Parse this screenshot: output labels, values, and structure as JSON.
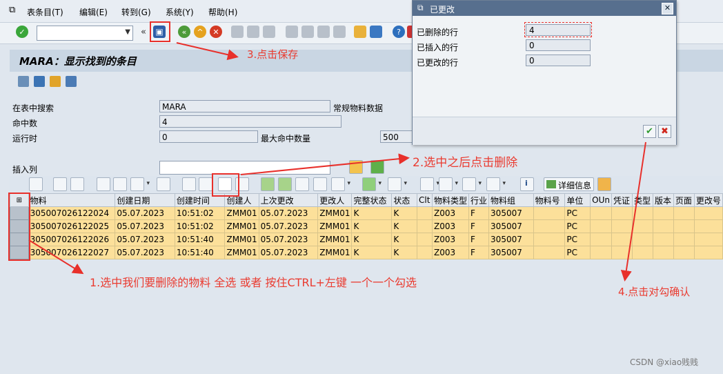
{
  "menu": {
    "items": [
      "表条目(T)",
      "编辑(E)",
      "转到(G)",
      "系统(Y)",
      "帮助(H)"
    ]
  },
  "toolbar": {
    "command_value": ""
  },
  "screen": {
    "title": "MARA：显示找到的条目"
  },
  "form": {
    "search_label": "在表中搜索",
    "search_value": "MARA",
    "search_desc": "常规物料数据",
    "hits_label": "命中数",
    "hits_value": "4",
    "runtime_label": "运行时",
    "runtime_value": "0",
    "maxhits_label": "最大命中数量",
    "maxhits_value": "500",
    "insert_label": "插入列"
  },
  "alv": {
    "details_label": "详细信息"
  },
  "grid": {
    "columns": [
      "物料",
      "创建日期",
      "创建时间",
      "创建人",
      "上次更改",
      "更改人",
      "完整状态",
      "状态",
      "Clt",
      "物料类型",
      "行业",
      "物料组",
      "物料号",
      "单位",
      "OUn",
      "凭证",
      "类型",
      "版本",
      "页面",
      "更改号"
    ],
    "rows": [
      [
        "305007026122024",
        "05.07.2023",
        "10:51:02",
        "ZMM01",
        "05.07.2023",
        "ZMM01",
        "K",
        "K",
        "",
        "Z003",
        "F",
        "305007",
        "",
        "PC",
        "",
        "",
        "",
        "",
        "",
        ""
      ],
      [
        "305007026122025",
        "05.07.2023",
        "10:51:02",
        "ZMM01",
        "05.07.2023",
        "ZMM01",
        "K",
        "K",
        "",
        "Z003",
        "F",
        "305007",
        "",
        "PC",
        "",
        "",
        "",
        "",
        "",
        ""
      ],
      [
        "305007026122026",
        "05.07.2023",
        "10:51:40",
        "ZMM01",
        "05.07.2023",
        "ZMM01",
        "K",
        "K",
        "",
        "Z003",
        "F",
        "305007",
        "",
        "PC",
        "",
        "",
        "",
        "",
        "",
        ""
      ],
      [
        "305007026122027",
        "05.07.2023",
        "10:51:40",
        "ZMM01",
        "05.07.2023",
        "ZMM01",
        "K",
        "K",
        "",
        "Z003",
        "F",
        "305007",
        "",
        "PC",
        "",
        "",
        "",
        "",
        "",
        ""
      ]
    ]
  },
  "dialog": {
    "title": "已更改",
    "deleted_label": "已删除的行",
    "deleted_value": "4",
    "inserted_label": "已插入的行",
    "inserted_value": "0",
    "changed_label": "已更改的行",
    "changed_value": "0",
    "close_glyph": "✕",
    "ok_glyph": "✔",
    "cancel_glyph": "✖"
  },
  "annotations": {
    "step1": "1.选中我们要删除的物料  全选 或者 按住CTRL+左键 一个一个勾选",
    "step2": "2.选中之后点击删除",
    "step3": "3.点击保存",
    "step4": "4.点击对勾确认"
  },
  "watermark": "CSDN @xiao贱贱",
  "colors": {
    "row_highlight": "#fce09a",
    "dialog_title": "#576f8e",
    "annotation": "#ea3b30"
  }
}
